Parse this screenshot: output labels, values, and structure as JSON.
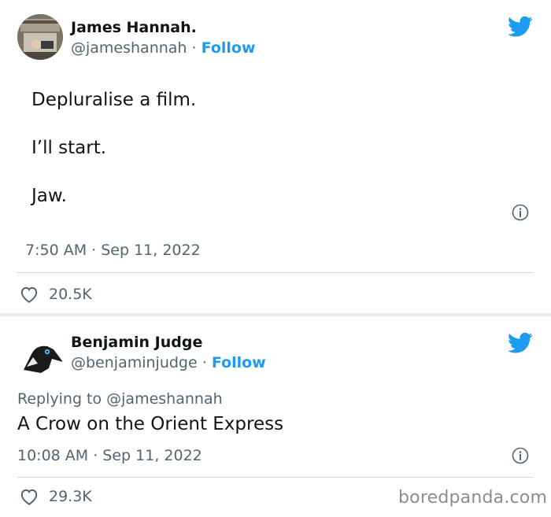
{
  "tweets": [
    {
      "author_name": "James Hannah.",
      "handle": "@jameshannah",
      "separator": " · ",
      "follow_label": "Follow",
      "lines": [
        "Depluralise a film.",
        "I’ll start.",
        "Jaw."
      ],
      "time": "7:50 AM · Sep 11, 2022",
      "likes": "20.5K",
      "icons": {
        "avatar": "avatar-photo",
        "platform": "twitter-bird-icon",
        "info": "info-icon",
        "like": "heart-icon"
      }
    },
    {
      "author_name": "Benjamin Judge",
      "handle": "@benjaminjudge",
      "separator": " · ",
      "follow_label": "Follow",
      "replying_to_prefix": "Replying to ",
      "replying_to_handle": "@jameshannah",
      "text": "A Crow on the Orient Express",
      "time": "10:08 AM · Sep 11, 2022",
      "likes": "29.3K",
      "icons": {
        "avatar": "crow-avatar",
        "platform": "twitter-bird-icon",
        "info": "info-icon",
        "like": "heart-icon"
      }
    }
  ],
  "watermark": "boredpanda.com",
  "colors": {
    "accent": "#1d9bf0",
    "text": "#0f1419",
    "muted": "#536471",
    "divider": "#cfd9de"
  }
}
